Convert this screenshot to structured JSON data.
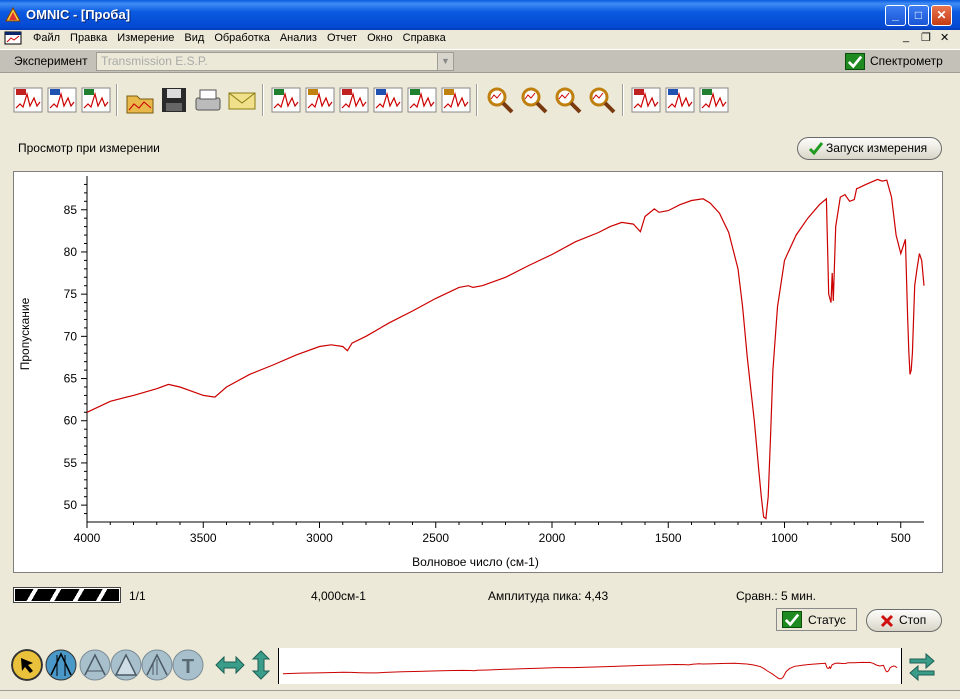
{
  "window": {
    "title": "OMNIC - [Проба]",
    "minimize": "_",
    "maximize": "□",
    "close": "✕"
  },
  "menu": {
    "items": [
      "Файл",
      "Правка",
      "Измерение",
      "Вид",
      "Обработка",
      "Анализ",
      "Отчет",
      "Окно",
      "Справка"
    ],
    "mdi_minimize": "_",
    "mdi_restore": "❐",
    "mdi_close": "✕"
  },
  "experiment": {
    "label": "Эксперимент",
    "selected": "Transmission E.S.P.",
    "spectrometer_label": "Спектрометр",
    "spectrometer_checked": true
  },
  "toolbar": {
    "groups": [
      [
        "collect-sample-icon",
        "collect-background-icon",
        "collect-series-icon"
      ],
      [
        "open-icon",
        "save-icon",
        "print-icon",
        "mail-icon"
      ],
      [
        "baseline-correct-icon",
        "automatic-baseline-icon",
        "subtract-icon",
        "smooth-icon",
        "normalize-icon",
        "find-peaks-icon"
      ],
      [
        "library-search-icon",
        "spectral-tools-icon",
        "quant-search-icon",
        "ir-signal-icon"
      ],
      [
        "report-icon",
        "print-report-icon",
        "analysis-icon"
      ]
    ]
  },
  "collection": {
    "preview_label": "Просмотр при измерении",
    "start_button": "Запуск измерения"
  },
  "chart_data": {
    "type": "line",
    "xlabel": "Волновое число (см-1)",
    "ylabel": "Пропускание",
    "xlim": [
      4000,
      400
    ],
    "ylim": [
      48,
      89
    ],
    "x_ticks": [
      4000,
      3500,
      3000,
      2500,
      2000,
      1500,
      1000,
      500
    ],
    "y_ticks": [
      50,
      55,
      60,
      65,
      70,
      75,
      80,
      85
    ],
    "grid": false,
    "color": "#cc0000",
    "series": [
      {
        "x": [
          4000,
          3900,
          3800,
          3700,
          3650,
          3600,
          3550,
          3500,
          3450,
          3400,
          3300,
          3200,
          3100,
          3000,
          2950,
          2900,
          2880,
          2860,
          2800,
          2700,
          2600,
          2500,
          2400,
          2360,
          2340,
          2300,
          2200,
          2100,
          2000,
          1900,
          1800,
          1750,
          1700,
          1650,
          1620,
          1600,
          1560,
          1540,
          1500,
          1450,
          1400,
          1350,
          1320,
          1280,
          1240,
          1200,
          1180,
          1160,
          1150,
          1130,
          1110,
          1100,
          1090,
          1080,
          1070,
          1060,
          1050,
          1030,
          1000,
          950,
          900,
          850,
          820,
          810,
          800,
          795,
          790,
          780,
          760,
          740,
          720,
          700,
          690,
          680,
          650,
          600,
          580,
          560,
          540,
          520,
          500,
          480,
          470,
          465,
          460,
          455,
          450,
          440,
          430,
          420,
          410,
          400
        ],
        "y": [
          61,
          62.3,
          63,
          63.8,
          64.3,
          64,
          63.5,
          63,
          62.8,
          64,
          65.5,
          66.6,
          67.8,
          68.8,
          69,
          68.8,
          68.3,
          69.2,
          70,
          71.6,
          73,
          74.5,
          75.8,
          76,
          75.8,
          76,
          77,
          78.4,
          79.7,
          81.2,
          82.3,
          83,
          83.5,
          83.3,
          82.4,
          84.2,
          85.1,
          84.7,
          84.9,
          85.6,
          86.1,
          86.3,
          85.8,
          84.6,
          82.3,
          78,
          73.5,
          67.5,
          65,
          60,
          54,
          51,
          48.6,
          48.4,
          51,
          58,
          66,
          73.5,
          79,
          82,
          84,
          85.6,
          86.3,
          75,
          74,
          77.5,
          74.2,
          83,
          86.5,
          86.8,
          86,
          86.2,
          87.5,
          87.6,
          88,
          88.6,
          88.4,
          88.5,
          86.5,
          82,
          79.8,
          81.5,
          72,
          68,
          65.5,
          66,
          68,
          76,
          78,
          79.8,
          79,
          76
        ]
      }
    ]
  },
  "status": {
    "progress_fraction": 1.0,
    "scan_count": "1/1",
    "resolution": "4,000см-1",
    "peak_amplitude": "Амплитуда пика: 4,43",
    "compare": "Сравн.: 5 мин.",
    "status_label": "Статус",
    "stop_label": "Стоп"
  },
  "bottom_tools": {
    "cursor_tools": [
      "pointer-icon",
      "region-icon",
      "peak-height-icon",
      "peak-area-icon",
      "spectral-subtract-icon",
      "text-icon"
    ],
    "view_tools": [
      "full-scale-icon",
      "common-scale-icon"
    ],
    "nav_tools": [
      "shift-view-icon"
    ]
  }
}
